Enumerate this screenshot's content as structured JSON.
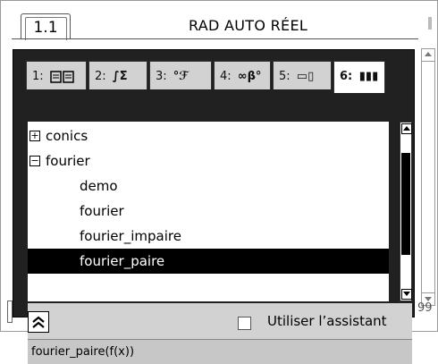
{
  "document": {
    "tab_label": "1.1",
    "status": "RAD AUTO RÉEL",
    "partial_right_value": "99"
  },
  "catalog": {
    "tabs": [
      {
        "label": "1:",
        "icon": "book-icon"
      },
      {
        "label": "2:",
        "icon": "integral-sum-icon",
        "glyph": "∫Σ"
      },
      {
        "label": "3:",
        "icon": "units-icon",
        "glyph": "°ℱ"
      },
      {
        "label": "4:",
        "icon": "symbols-icon",
        "glyph": "∞β°"
      },
      {
        "label": "5:",
        "icon": "templates-icon",
        "glyph": "▭▯"
      },
      {
        "label": "6:",
        "icon": "library-icon",
        "glyph": "▮▮▮",
        "active": true
      }
    ],
    "items": [
      {
        "label": "conics",
        "expander": "+",
        "selected": false
      },
      {
        "label": "fourier",
        "expander": "−",
        "selected": false
      },
      {
        "label": "demo",
        "selected": false
      },
      {
        "label": "fourier",
        "selected": false
      },
      {
        "label": "fourier_impaire",
        "selected": false
      },
      {
        "label": "fourier_paire",
        "selected": true
      }
    ],
    "wizard_label": "Utiliser l’assistant",
    "wizard_checked": false,
    "syntax": "fourier_paire(f(x))"
  }
}
